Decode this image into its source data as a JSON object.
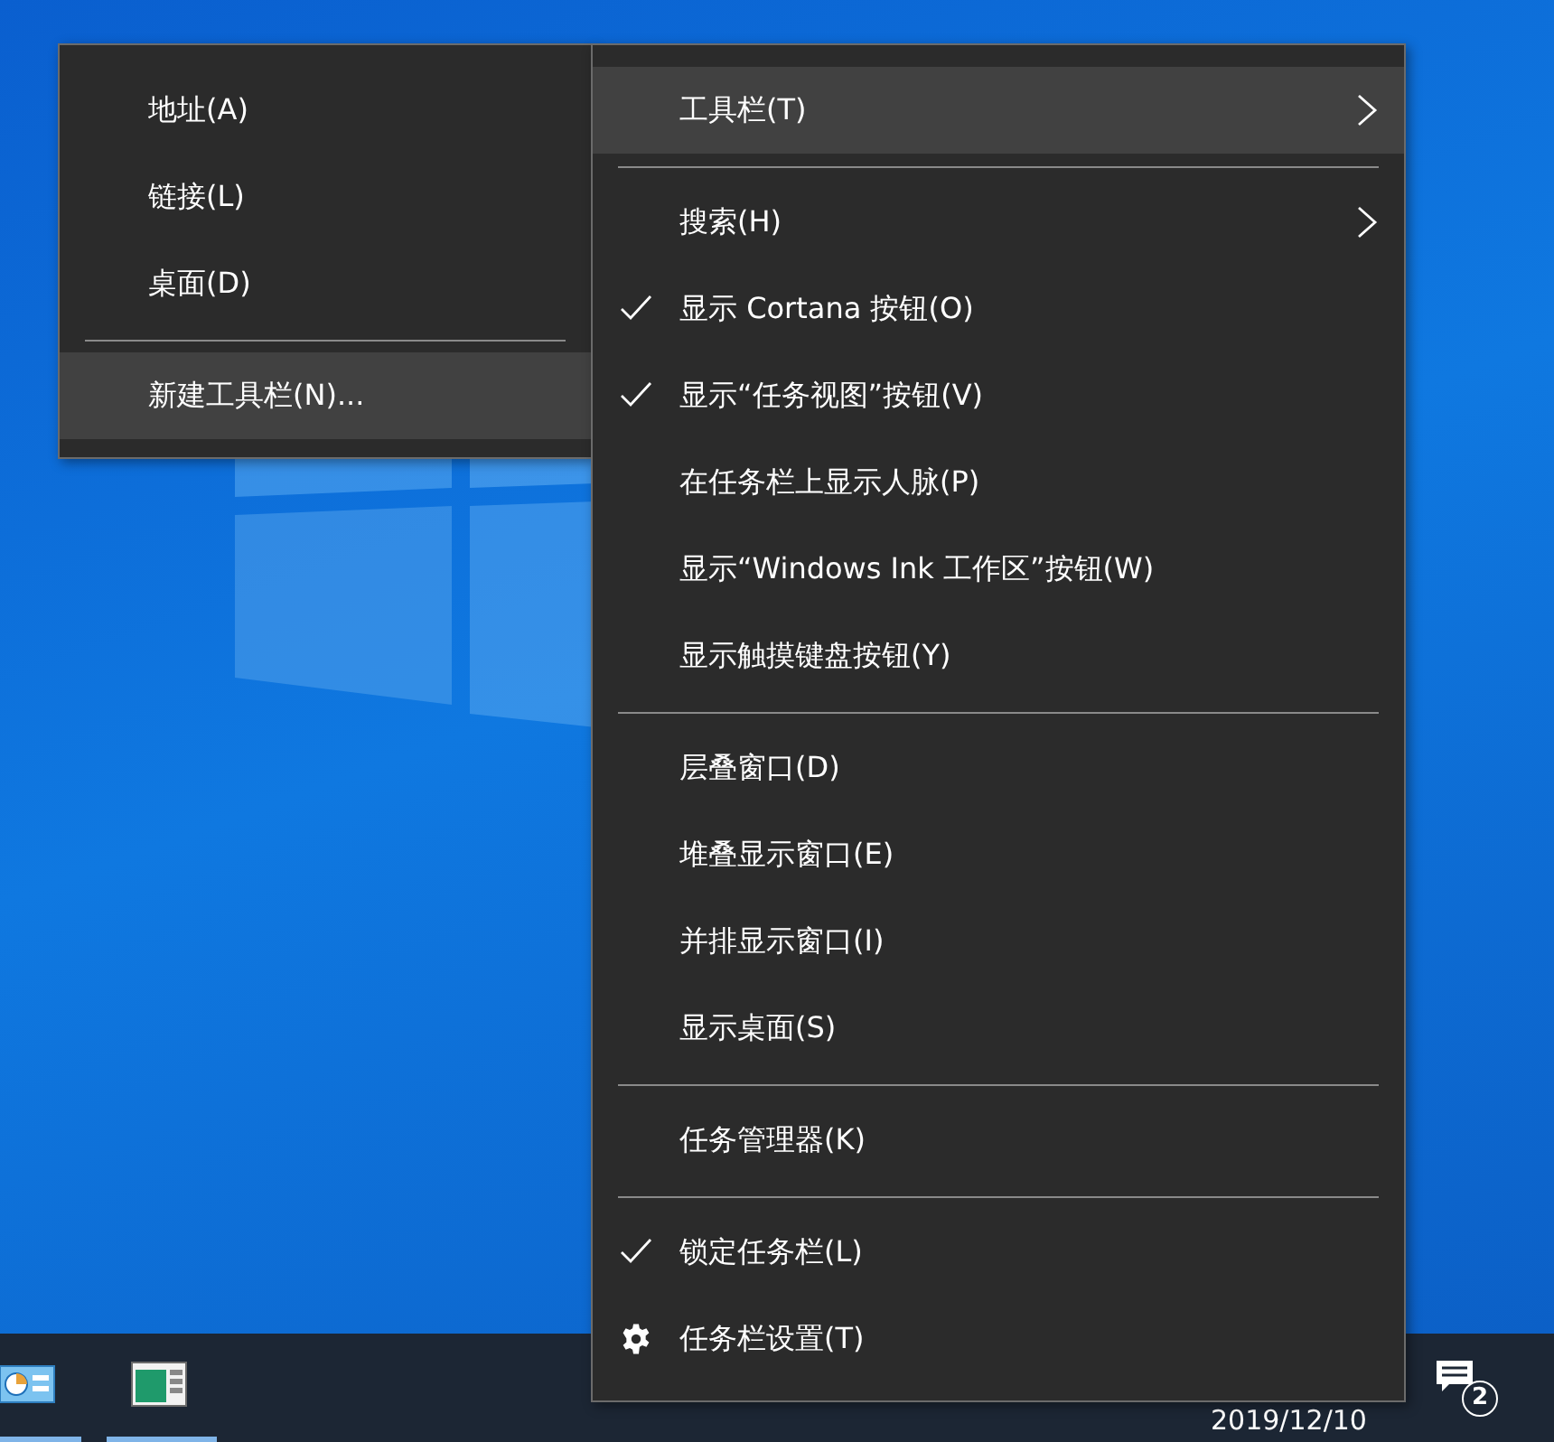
{
  "context_menu": {
    "items": [
      {
        "kind": "item",
        "label": "工具栏(T)",
        "selected": true,
        "checked": false,
        "submenu": true
      },
      {
        "kind": "separator"
      },
      {
        "kind": "item",
        "label": "搜索(H)",
        "selected": false,
        "checked": false,
        "submenu": true
      },
      {
        "kind": "item",
        "label": "显示 Cortana 按钮(O)",
        "selected": false,
        "checked": true,
        "submenu": false
      },
      {
        "kind": "item",
        "label": "显示“任务视图”按钮(V)",
        "selected": false,
        "checked": true,
        "submenu": false
      },
      {
        "kind": "item",
        "label": "在任务栏上显示人脉(P)",
        "selected": false,
        "checked": false,
        "submenu": false
      },
      {
        "kind": "item",
        "label": "显示“Windows Ink 工作区”按钮(W)",
        "selected": false,
        "checked": false,
        "submenu": false
      },
      {
        "kind": "item",
        "label": "显示触摸键盘按钮(Y)",
        "selected": false,
        "checked": false,
        "submenu": false
      },
      {
        "kind": "separator"
      },
      {
        "kind": "item",
        "label": "层叠窗口(D)",
        "selected": false,
        "checked": false,
        "submenu": false
      },
      {
        "kind": "item",
        "label": "堆叠显示窗口(E)",
        "selected": false,
        "checked": false,
        "submenu": false
      },
      {
        "kind": "item",
        "label": "并排显示窗口(I)",
        "selected": false,
        "checked": false,
        "submenu": false
      },
      {
        "kind": "item",
        "label": "显示桌面(S)",
        "selected": false,
        "checked": false,
        "submenu": false
      },
      {
        "kind": "separator"
      },
      {
        "kind": "item",
        "label": "任务管理器(K)",
        "selected": false,
        "checked": false,
        "submenu": false
      },
      {
        "kind": "separator"
      },
      {
        "kind": "item",
        "label": "锁定任务栏(L)",
        "selected": false,
        "checked": true,
        "submenu": false
      },
      {
        "kind": "settings",
        "label": "任务栏设置(T)",
        "selected": false,
        "submenu": false
      }
    ]
  },
  "toolbar_submenu": {
    "items": [
      {
        "kind": "item",
        "label": "地址(A)",
        "selected": false
      },
      {
        "kind": "item",
        "label": "链接(L)",
        "selected": false
      },
      {
        "kind": "item",
        "label": "桌面(D)",
        "selected": false
      },
      {
        "kind": "separator"
      },
      {
        "kind": "item",
        "label": "新建工具栏(N)...",
        "selected": true
      }
    ]
  },
  "taskbar": {
    "apps": [
      {
        "kind": "control-panel",
        "active": true
      },
      {
        "kind": "window",
        "active": true
      }
    ],
    "clock_date": "2019/12/10",
    "notification_count": "2"
  }
}
